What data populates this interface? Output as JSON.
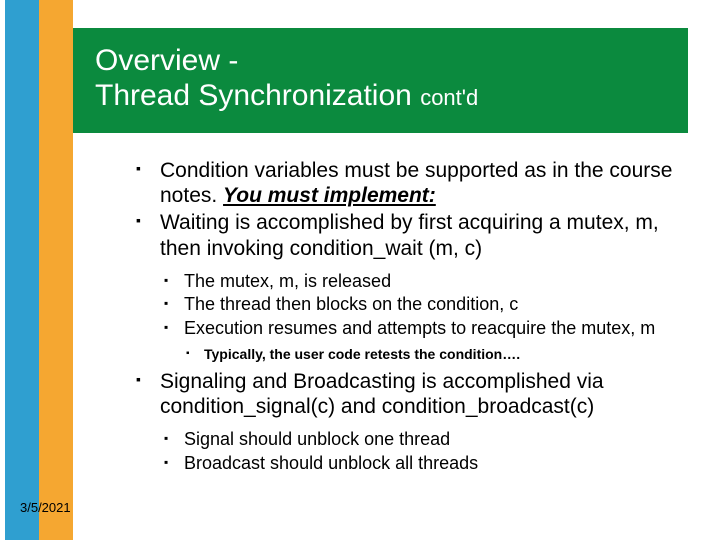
{
  "title": {
    "line1": "Overview -",
    "line2_main": "Thread Synchronization ",
    "line2_suffix": "cont'd"
  },
  "bullets": {
    "b1_a": "Condition variables must be supported as in the course notes. ",
    "b1_b_emph": "You must implement:",
    "b2": "Waiting is accomplished by first acquiring a mutex, m, then invoking condition_wait (m, c)",
    "b2_sub1": "The mutex, m, is released",
    "b2_sub2": "The thread then blocks on the condition, c",
    "b2_sub3": "Execution resumes and attempts to reacquire the mutex, m",
    "b2_sub3_sub1": "Typically, the user code retests the condition….",
    "b3": "Signaling and Broadcasting is accomplished via condition_signal(c) and condition_broadcast(c)",
    "b3_sub1": "Signal should unblock one thread",
    "b3_sub2": "Broadcast should unblock all threads"
  },
  "date": "3/5/2021"
}
